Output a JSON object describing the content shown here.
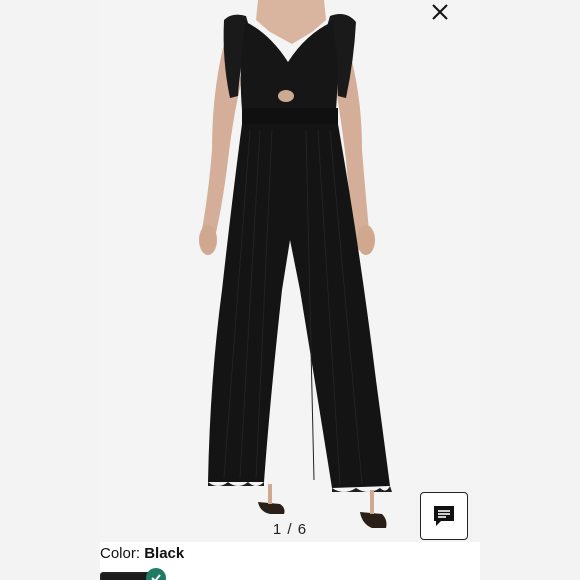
{
  "viewer": {
    "image_alt": "Black sleeveless wide-leg jumpsuit with ruffle straps",
    "counter": "1 / 6",
    "close_icon": "close-icon",
    "chat_icon": "chat-icon"
  },
  "product": {
    "color_label": "Color: ",
    "color_value": "Black",
    "swatch_selected_icon": "check-icon"
  },
  "colors": {
    "accent": "#1f7a66",
    "garment": "#141414",
    "background": "#f4f4f4"
  }
}
